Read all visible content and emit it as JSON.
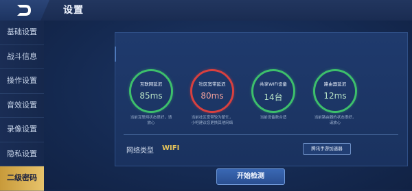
{
  "header": {
    "title": "设置"
  },
  "sidebar": {
    "items": [
      {
        "label": "基础设置"
      },
      {
        "label": "战斗信息"
      },
      {
        "label": "操作设置"
      },
      {
        "label": "音效设置"
      },
      {
        "label": "录像设置"
      },
      {
        "label": "隐私设置"
      },
      {
        "label": "二级密码"
      }
    ]
  },
  "stats": [
    {
      "label": "互联网延迟",
      "value": "85ms",
      "status_color": "#3dbf6b",
      "desc_line1": "当前互联网状态很好，请",
      "desc_line2": "放心"
    },
    {
      "label": "社区宽带延迟",
      "value": "80ms",
      "status_color": "#d8403f",
      "desc_line1": "当前社区宽带较为繁忙，",
      "desc_line2": "小吧建议您更换其他网络"
    },
    {
      "label": "共享WIFI设备",
      "value": "14台",
      "status_color": "#3dbf6b",
      "desc_line1": "当前设备数合适",
      "desc_line2": ""
    },
    {
      "label": "路由器延迟",
      "value": "12ms",
      "status_color": "#3dbf6b",
      "desc_line1": "当前路由器的状态很好，",
      "desc_line2": "请放心"
    }
  ],
  "network": {
    "type_label": "网络类型",
    "type_value": "WIFI",
    "speedup_label": "腾讯手游加速器"
  },
  "actions": {
    "start_label": "开始检测"
  },
  "colors": {
    "accent_gold": "#e6c45a",
    "good": "#3dbf6b",
    "bad": "#d8403f"
  }
}
